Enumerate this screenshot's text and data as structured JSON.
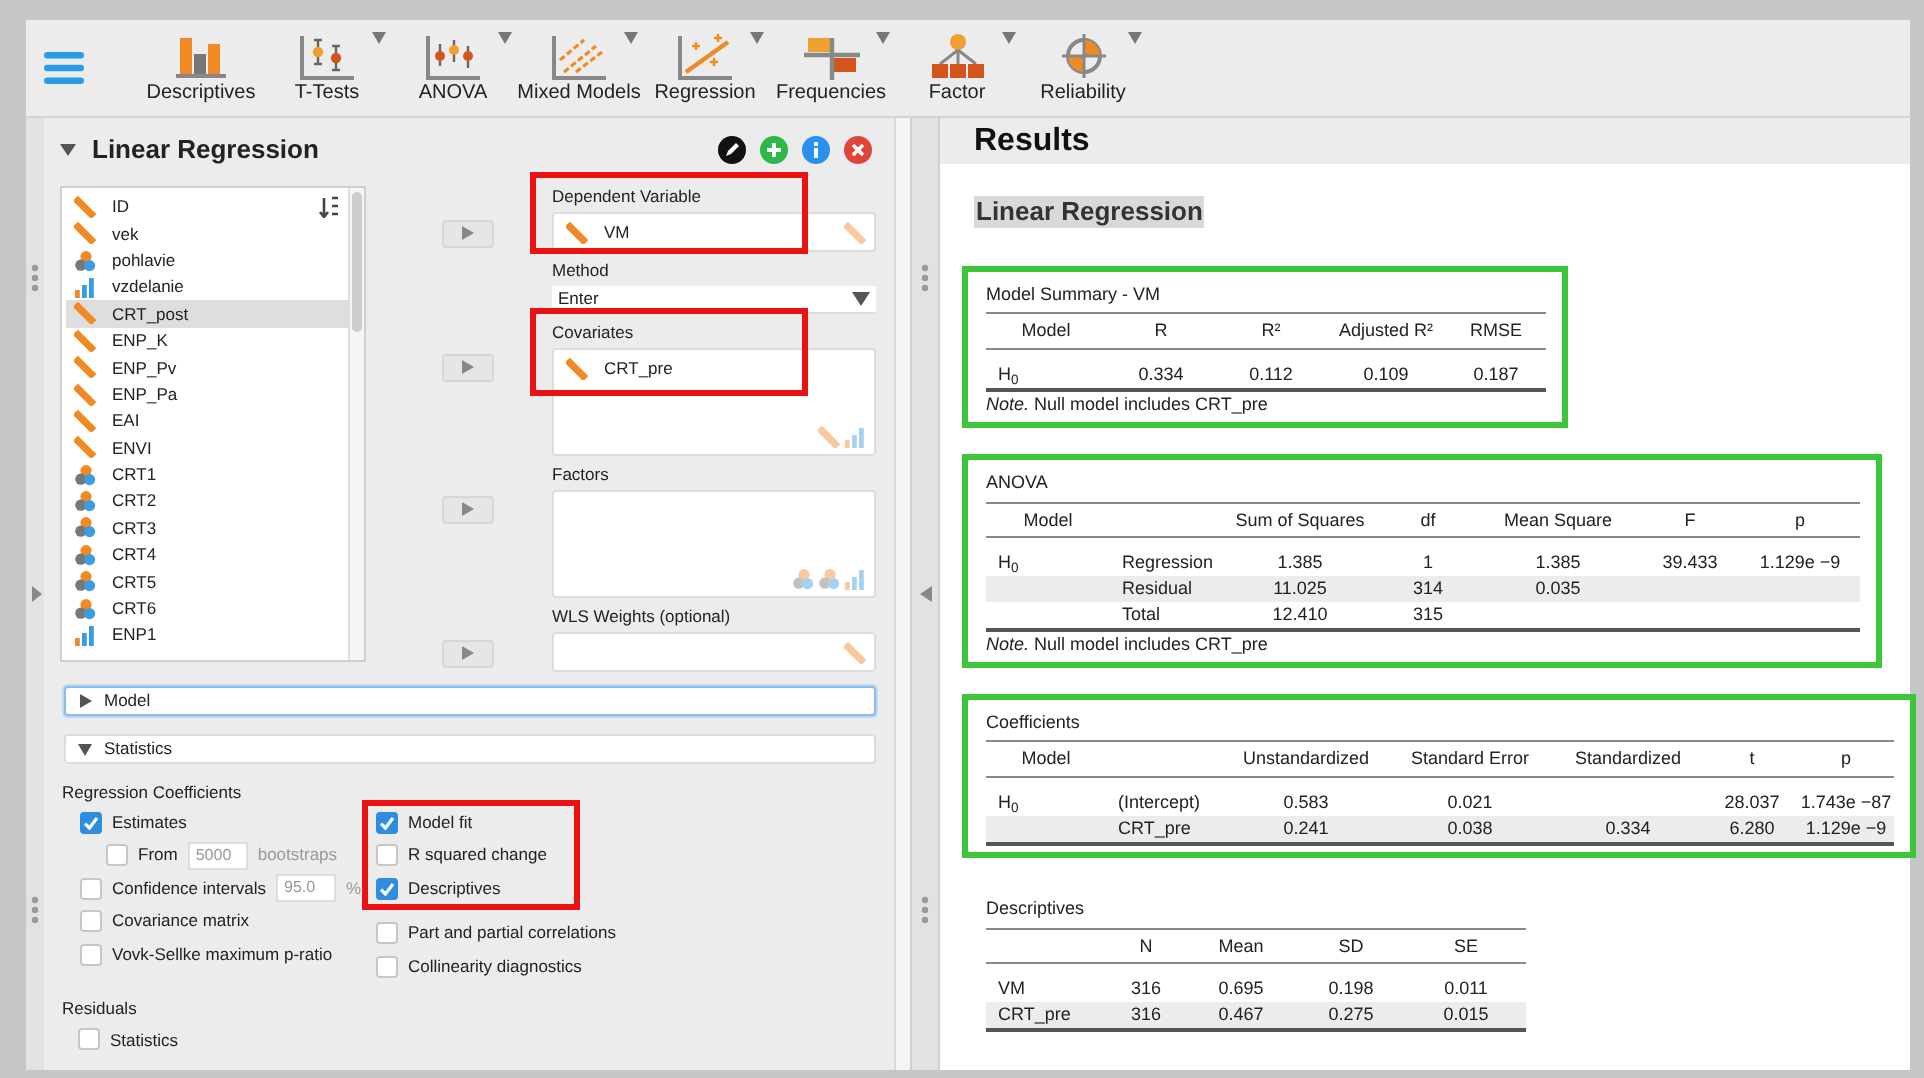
{
  "toolbar": {
    "modules": [
      {
        "label": "Descriptives",
        "dropdown": false
      },
      {
        "label": "T-Tests",
        "dropdown": true
      },
      {
        "label": "ANOVA",
        "dropdown": true
      },
      {
        "label": "Mixed Models",
        "dropdown": true
      },
      {
        "label": "Regression",
        "dropdown": true
      },
      {
        "label": "Frequencies",
        "dropdown": true
      },
      {
        "label": "Factor",
        "dropdown": true
      },
      {
        "label": "Reliability",
        "dropdown": true
      }
    ]
  },
  "analysis": {
    "title": "Linear Regression",
    "expanded": true,
    "variables": [
      {
        "name": "ID",
        "kind": "scale",
        "selected": false
      },
      {
        "name": "vek",
        "kind": "scale",
        "selected": false
      },
      {
        "name": "pohlavie",
        "kind": "nominal",
        "selected": false
      },
      {
        "name": "vzdelanie",
        "kind": "ordinal",
        "selected": false
      },
      {
        "name": "CRT_post",
        "kind": "scale",
        "selected": true
      },
      {
        "name": "ENP_K",
        "kind": "scale",
        "selected": false
      },
      {
        "name": "ENP_Pv",
        "kind": "scale",
        "selected": false
      },
      {
        "name": "ENP_Pa",
        "kind": "scale",
        "selected": false
      },
      {
        "name": "EAI",
        "kind": "scale",
        "selected": false
      },
      {
        "name": "ENVI",
        "kind": "scale",
        "selected": false
      },
      {
        "name": "CRT1",
        "kind": "nominal",
        "selected": false
      },
      {
        "name": "CRT2",
        "kind": "nominal",
        "selected": false
      },
      {
        "name": "CRT3",
        "kind": "nominal",
        "selected": false
      },
      {
        "name": "CRT4",
        "kind": "nominal",
        "selected": false
      },
      {
        "name": "CRT5",
        "kind": "nominal",
        "selected": false
      },
      {
        "name": "CRT6",
        "kind": "nominal",
        "selected": false
      },
      {
        "name": "ENP1",
        "kind": "ordinal",
        "selected": false
      }
    ],
    "fields": [
      {
        "kind": "list",
        "label": "Dependent Variable",
        "items": [
          {
            "name": "VM",
            "kind": "scale"
          }
        ],
        "allowed": [
          {
            "kind": "scale"
          }
        ],
        "highlighted": true,
        "multiple": false
      },
      {
        "kind": "dropdown",
        "label": "Method",
        "value": "Enter"
      },
      {
        "kind": "list",
        "label": "Covariates",
        "items": [
          {
            "name": "CRT_pre",
            "kind": "scale"
          }
        ],
        "allowed": [
          {
            "kind": "scale"
          },
          {
            "kind": "ordinal"
          }
        ],
        "highlighted": true,
        "multiple": true
      },
      {
        "kind": "list",
        "label": "Factors",
        "allowed": [
          {
            "kind": "nominal"
          },
          {
            "kind": "nominal"
          },
          {
            "kind": "ordinal"
          }
        ],
        "highlighted": false,
        "multiple": true
      },
      {
        "kind": "list",
        "label": "WLS Weights (optional)",
        "allowed": [
          {
            "kind": "scale"
          }
        ],
        "highlighted": false,
        "multiple": false
      }
    ],
    "sections": [
      {
        "label": "Model",
        "expanded": false,
        "focused": true
      },
      {
        "label": "Statistics",
        "expanded": true,
        "focused": false
      }
    ],
    "statistics": {
      "heading": "Regression Coefficients",
      "left": [
        {
          "label": "Estimates",
          "checked": true,
          "children": [
            {
              "label": "From",
              "checked": false,
              "field": "5000",
              "suffix": "bootstraps",
              "field_disabled": true
            }
          ]
        },
        {
          "label": "Confidence intervals",
          "checked": false,
          "field": "95.0",
          "suffix": "%",
          "field_disabled": true
        },
        {
          "label": "Covariance matrix",
          "checked": false
        },
        {
          "label": "Vovk-Sellke maximum p-ratio",
          "checked": false
        }
      ],
      "right_groups": [
        {
          "highlighted": true,
          "options": [
            {
              "label": "Model fit",
              "checked": true
            },
            {
              "label": "R squared change",
              "checked": false
            },
            {
              "label": "Descriptives",
              "checked": true
            }
          ]
        },
        {
          "highlighted": false,
          "options": [
            {
              "label": "Part and partial correlations",
              "checked": false
            },
            {
              "label": "Collinearity diagnostics",
              "checked": false
            }
          ]
        }
      ],
      "residuals_heading": "Residuals",
      "residuals": [
        {
          "label": "Statistics",
          "checked": false
        }
      ]
    }
  },
  "results": {
    "title": "Results",
    "heading": "Linear Regression",
    "tables": [
      {
        "title": "Model Summary - VM",
        "highlighted": true,
        "columns": [
          "Model",
          "R",
          "R²",
          "Adjusted R²",
          "RMSE"
        ],
        "rows": [
          {
            "cells": [
              "H$_{0}$",
              "0.334",
              "0.112",
              "0.109",
              "0.187"
            ],
            "shaded": false
          }
        ],
        "note": "*Note.* Null model includes CRT_pre"
      },
      {
        "title": "ANOVA",
        "highlighted": true,
        "columns": [
          "Model",
          null,
          "Sum of Squares",
          "df",
          "Mean Square",
          "F",
          "p"
        ],
        "rows": [
          {
            "cells": [
              "H$_{0}$",
              "Regression",
              "1.385",
              "1",
              "1.385",
              "39.433",
              "1.129e −9"
            ],
            "shaded": false
          },
          {
            "cells": [
              null,
              "Residual",
              "11.025",
              "314",
              "0.035",
              null,
              null
            ],
            "shaded": true
          },
          {
            "cells": [
              null,
              "Total",
              "12.410",
              "315",
              null,
              null,
              null
            ],
            "shaded": false
          }
        ],
        "note": "*Note.* Null model includes CRT_pre"
      },
      {
        "title": "Coefficients",
        "highlighted": true,
        "columns": [
          "Model",
          null,
          "Unstandardized",
          "Standard Error",
          "Standardized",
          "t",
          "p"
        ],
        "rows": [
          {
            "cells": [
              "H$_{0}$",
              "(Intercept)",
              "0.583",
              "0.021",
              null,
              "28.037",
              "1.743e −87"
            ],
            "shaded": false
          },
          {
            "cells": [
              null,
              "CRT_pre",
              "0.241",
              "0.038",
              "0.334",
              "6.280",
              "1.129e −9"
            ],
            "shaded": true
          }
        ]
      },
      {
        "title": "Descriptives",
        "highlighted": false,
        "columns": [
          null,
          "N",
          "Mean",
          "SD",
          "SE"
        ],
        "rows": [
          {
            "cells": [
              "VM",
              "316",
              "0.695",
              "0.198",
              "0.011"
            ],
            "shaded": false
          },
          {
            "cells": [
              "CRT_pre",
              "316",
              "0.467",
              "0.275",
              "0.015"
            ],
            "shaded": true
          }
        ]
      }
    ]
  }
}
